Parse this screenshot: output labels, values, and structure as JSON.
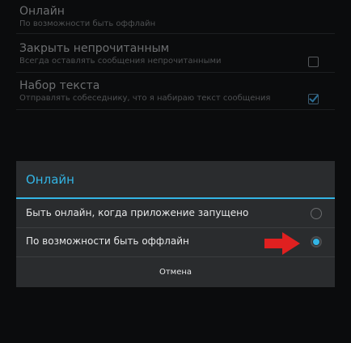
{
  "settings": {
    "items": [
      {
        "title": "Онлайн",
        "summary": "По возможности быть оффлайн",
        "checkbox": null
      },
      {
        "title": "Закрыть непрочитанным",
        "summary": "Всегда оставлять сообщения непрочитанными",
        "checkbox": "unchecked"
      },
      {
        "title": "Набор текста",
        "summary": "Отправлять собеседнику, что я набираю текст сообщения",
        "checkbox": "checked"
      }
    ]
  },
  "dialog": {
    "title": "Онлайн",
    "options": [
      {
        "label": "Быть онлайн, когда приложение запущено",
        "selected": false
      },
      {
        "label": "По возможности быть оффлайн",
        "selected": true
      }
    ],
    "cancel_label": "Отмена"
  },
  "colors": {
    "accent": "#33b5e5",
    "arrow": "#e02020",
    "dialog_bg": "#2a2c2e",
    "screen_bg": "#0b0c0d"
  },
  "icons": {
    "arrow": "red-arrow-right-icon"
  }
}
